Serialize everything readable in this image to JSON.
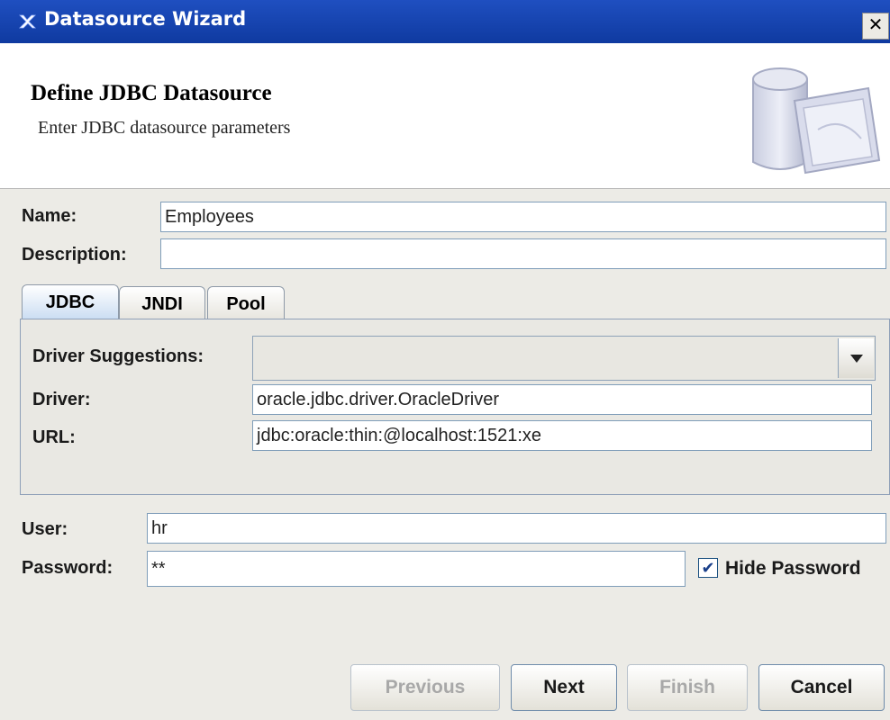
{
  "window": {
    "title": "Datasource Wizard",
    "close_glyph": "✕"
  },
  "header": {
    "title": "Define JDBC Datasource",
    "subtitle": "Enter JDBC datasource parameters",
    "illustration_icon": "database-folder-icon"
  },
  "form": {
    "name_label": "Name:",
    "name_value": "Employees",
    "description_label": "Description:",
    "description_value": ""
  },
  "tabs": [
    {
      "label": "JDBC",
      "active": true
    },
    {
      "label": "JNDI",
      "active": false
    },
    {
      "label": "Pool",
      "active": false
    }
  ],
  "jdbc": {
    "driver_suggestions_label": "Driver Suggestions:",
    "driver_suggestions_value": "",
    "driver_label": "Driver:",
    "driver_value": "oracle.jdbc.driver.OracleDriver",
    "url_label": "URL:",
    "url_value": "jdbc:oracle:thin:@localhost:1521:xe"
  },
  "credentials": {
    "user_label": "User:",
    "user_value": "hr",
    "password_label": "Password:",
    "password_value": "**",
    "hide_password_label": "Hide Password",
    "hide_password_checked": true,
    "check_glyph": "✔"
  },
  "buttons": {
    "previous": "Previous",
    "next": "Next",
    "finish": "Finish",
    "cancel": "Cancel"
  }
}
